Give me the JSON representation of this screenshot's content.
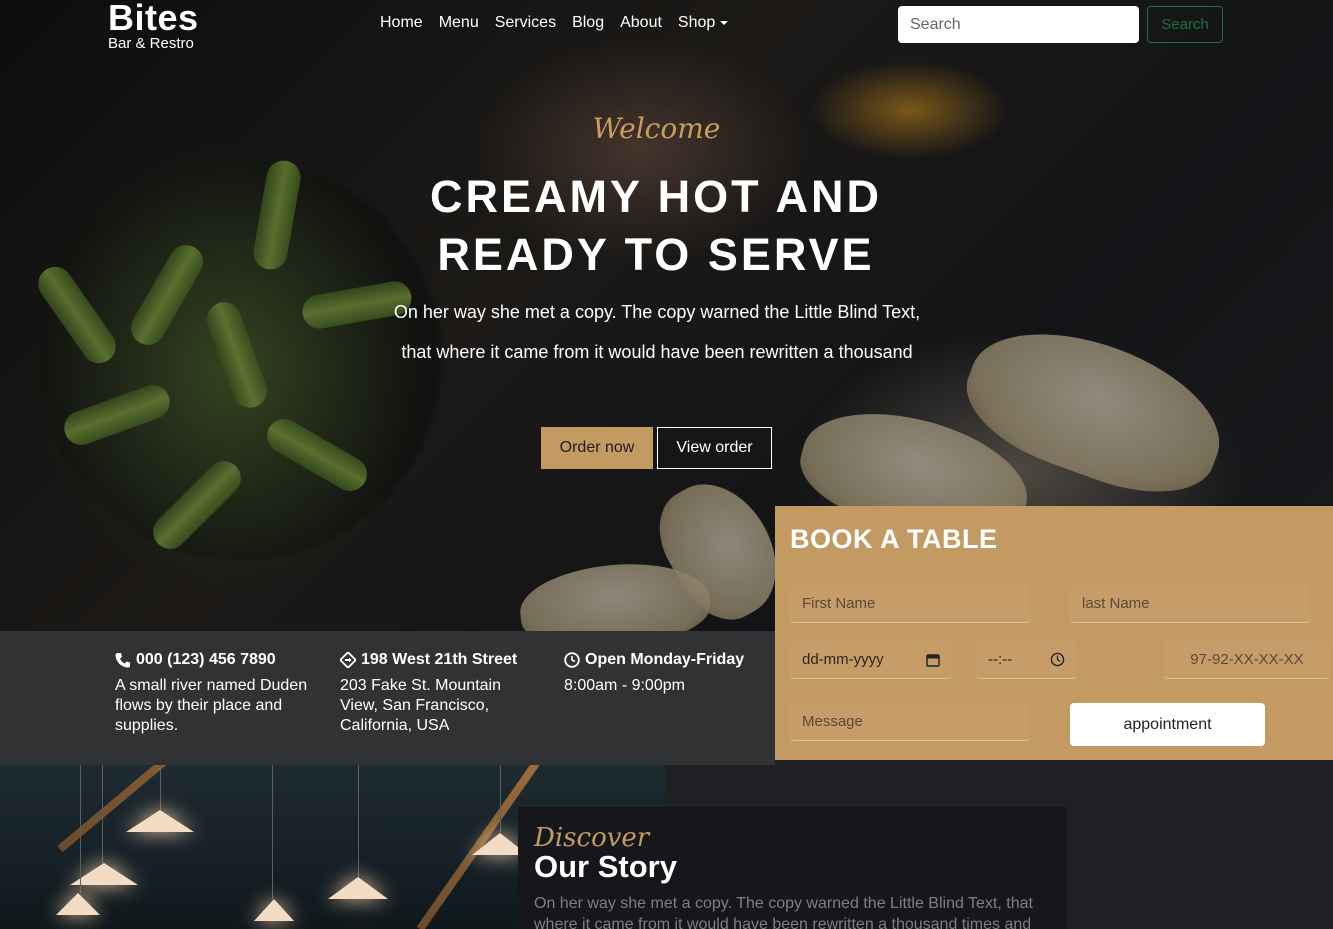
{
  "brand": {
    "name": "Bites",
    "tagline": "Bar & Restro"
  },
  "nav": {
    "items": [
      "Home",
      "Menu",
      "Services",
      "Blog",
      "About"
    ],
    "shop_label": "Shop",
    "search_placeholder": "Search",
    "search_button": "Search"
  },
  "hero": {
    "eyebrow": "Welcome",
    "title": "CREAMY HOT AND READY TO SERVE",
    "text": "On her way she met a copy. The copy warned the Little Blind Text, that where it came from it would have been rewritten a thousand",
    "order_button": "Order now",
    "view_button": "View order"
  },
  "info": [
    {
      "icon": "phone-icon",
      "heading": "000 (123) 456 7890",
      "text": "A small river named Duden flows by their place and supplies."
    },
    {
      "icon": "location-icon",
      "heading": "198 West 21th Street",
      "text": "203 Fake St. Mountain View, San Francisco, California, USA"
    },
    {
      "icon": "clock-icon",
      "heading": "Open Monday-Friday",
      "text": "8:00am - 9:00pm"
    }
  ],
  "booking": {
    "title": "BOOK A TABLE",
    "first_name_placeholder": "First Name",
    "last_name_placeholder": "last Name",
    "date_placeholder": "dd-mm-yyyy",
    "time_placeholder": "--:--",
    "phone_placeholder": "97-92-XX-XX-XX",
    "message_placeholder": "Message",
    "submit_label": "appointment"
  },
  "story": {
    "eyebrow": "Discover",
    "title": "Our Story",
    "text": "On her way she met a copy. The copy warned the Little Blind Text, that where it came from it would have been rewritten a thousand times and"
  },
  "colors": {
    "accent": "#c49a63",
    "dark": "#313234",
    "bg": "#1f2024",
    "search_outline": "#1f6f3c"
  }
}
